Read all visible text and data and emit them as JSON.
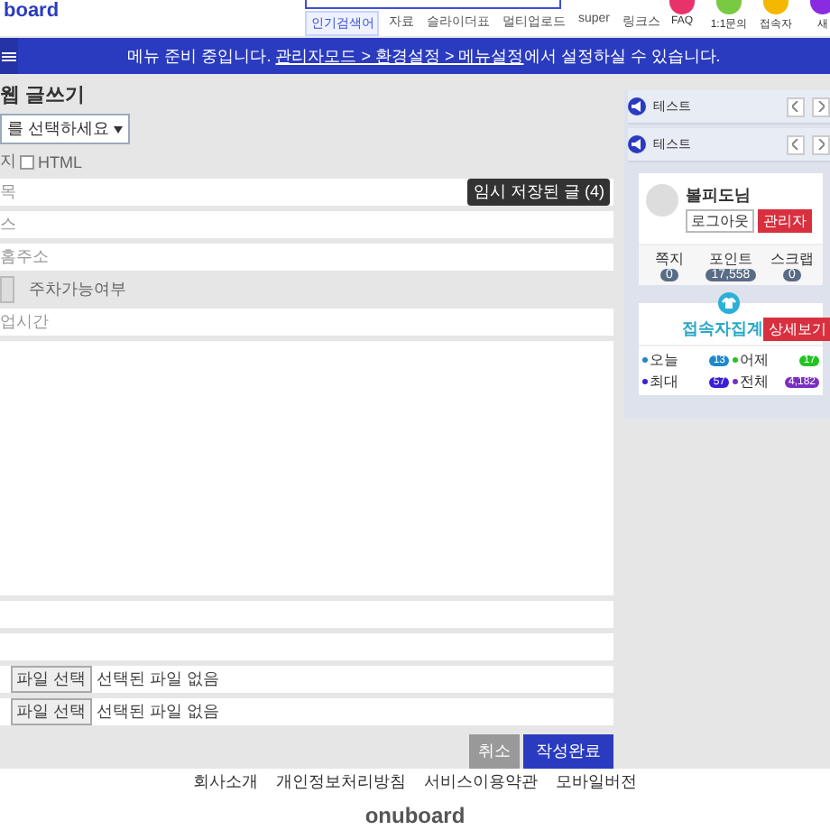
{
  "header": {
    "logo": "board",
    "search_tabs": [
      {
        "label": "인기검색어",
        "selected": true
      },
      {
        "label": "자료",
        "selected": false
      },
      {
        "label": "슬라이더표",
        "selected": false
      },
      {
        "label": "멀티업로드",
        "selected": false
      },
      {
        "label": "super",
        "selected": false
      },
      {
        "label": "링크스",
        "selected": false
      }
    ],
    "shortcuts": [
      {
        "label": "FAQ",
        "color": "#e8336a"
      },
      {
        "label": "1:1문의",
        "color": "#7ac943"
      },
      {
        "label": "접속자",
        "color": "#f5b800"
      },
      {
        "label": "새",
        "color": "#8a2be2"
      }
    ]
  },
  "notice_bar": {
    "before": "메뉴 준비 중입니다. ",
    "link": "관리자모드 > 환경설정 > 메뉴설정",
    "after": "에서 설정하실 수 있습니다."
  },
  "form": {
    "title": "웹 글쓰기",
    "category_select": "를 선택하세요",
    "options": {
      "label": "지",
      "checkbox": {
        "label": "HTML",
        "checked": false
      }
    },
    "temp_saved": "임시 저장된 글 (4)",
    "fields": [
      {
        "kind": "text",
        "placeholder": "목"
      },
      {
        "kind": "text",
        "placeholder": "스"
      },
      {
        "kind": "text",
        "placeholder": "홈주소"
      },
      {
        "kind": "toggle",
        "label": "주차가능여부"
      },
      {
        "kind": "text",
        "placeholder": "업시간"
      },
      {
        "kind": "textarea"
      },
      {
        "kind": "text"
      },
      {
        "kind": "text"
      },
      {
        "kind": "file",
        "button": "파일 선택",
        "status": "선택된 파일 없음"
      },
      {
        "kind": "file",
        "button": "파일 선택",
        "status": "선택된 파일 없음"
      }
    ],
    "buttons": [
      {
        "label": "취소",
        "kind": "cancel"
      },
      {
        "label": "작성완료",
        "kind": "submit"
      }
    ]
  },
  "sidebar": {
    "notices": [
      {
        "title": "테스트"
      },
      {
        "title": "테스트"
      }
    ],
    "profile": {
      "name": "볼피도님",
      "logout": "로그아웃",
      "admin": "관리자",
      "stats": [
        {
          "label": "쪽지",
          "value": "0"
        },
        {
          "label": "포인트",
          "value": "17,558"
        },
        {
          "label": "스크랩",
          "value": "0"
        }
      ]
    },
    "visitors": {
      "title": "접속자집계",
      "detail": "상세보기",
      "items": [
        {
          "label": "오늘",
          "value": "13",
          "color": "#1e88c8"
        },
        {
          "label": "어제",
          "value": "17",
          "color": "#22c422"
        },
        {
          "label": "최대",
          "value": "57",
          "color": "#3a1fd6"
        },
        {
          "label": "전체",
          "value": "4,182",
          "color": "#7b2fbf"
        }
      ]
    }
  },
  "footer": {
    "links": [
      "회사소개",
      "개인정보처리방침",
      "서비스이용약관",
      "모바일버전"
    ],
    "logo": "onuboard"
  }
}
